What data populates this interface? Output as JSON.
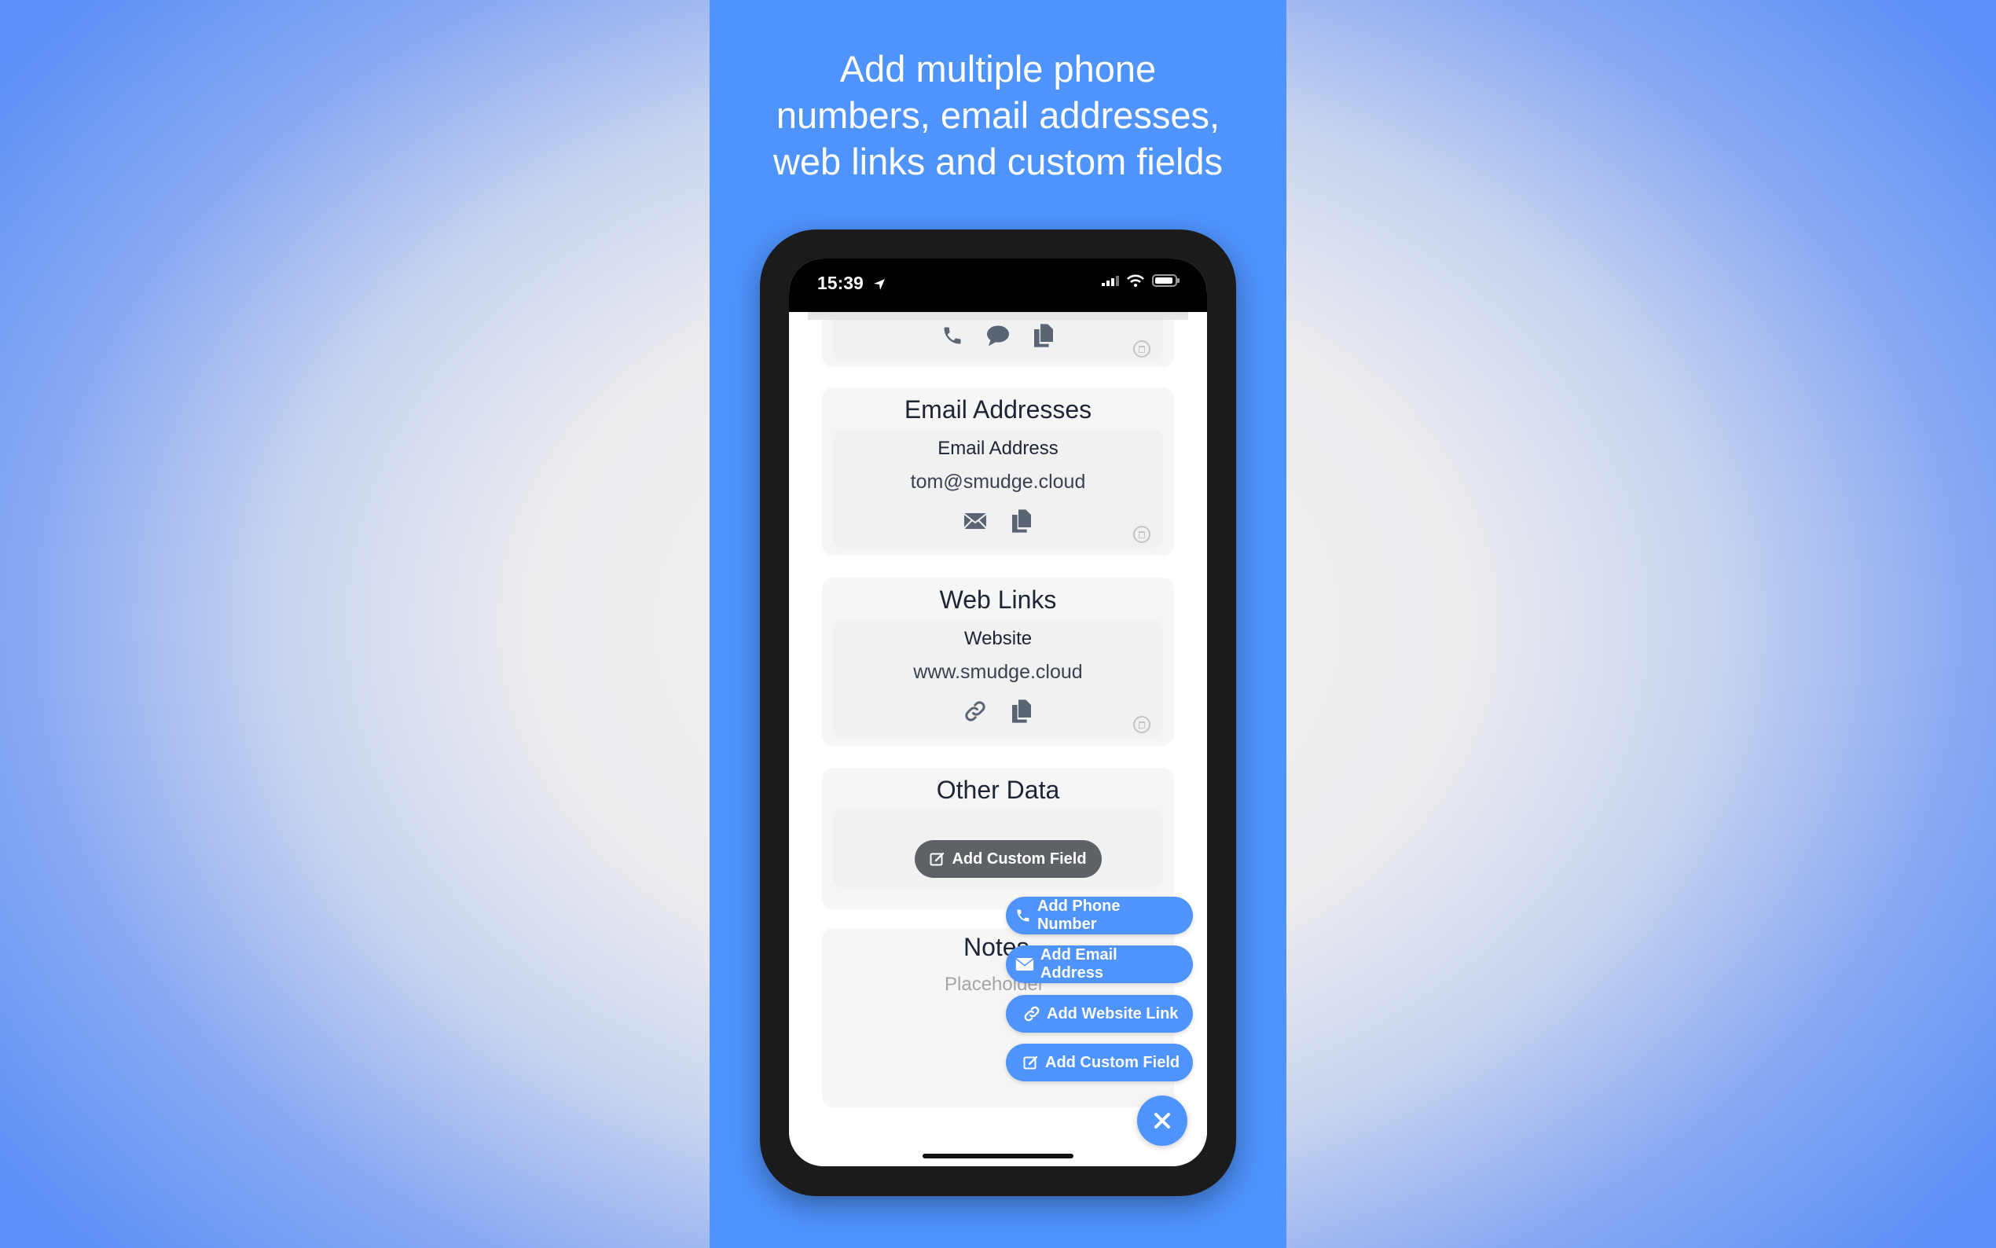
{
  "headline": {
    "line1": "Add multiple phone",
    "line2": "numbers, email addresses,",
    "line3": "web links and custom fields"
  },
  "status_bar": {
    "time": "15:39"
  },
  "email_section": {
    "title": "Email Addresses",
    "field_label": "Email Address",
    "field_value": "tom@smudge.cloud"
  },
  "web_section": {
    "title": "Web Links",
    "field_label": "Website",
    "field_value": "www.smudge.cloud"
  },
  "other_section": {
    "title": "Other Data",
    "add_custom_field": "Add Custom Field"
  },
  "notes_section": {
    "title": "Notes",
    "placeholder": "Placeholder"
  },
  "fab_menu": {
    "add_phone": "Add Phone Number",
    "add_email": "Add Email Address",
    "add_website": "Add Website Link",
    "add_custom": "Add Custom Field"
  },
  "colors": {
    "accent": "#4f93fd",
    "panel": "#4f93fd",
    "dark_button": "#5e6166"
  }
}
